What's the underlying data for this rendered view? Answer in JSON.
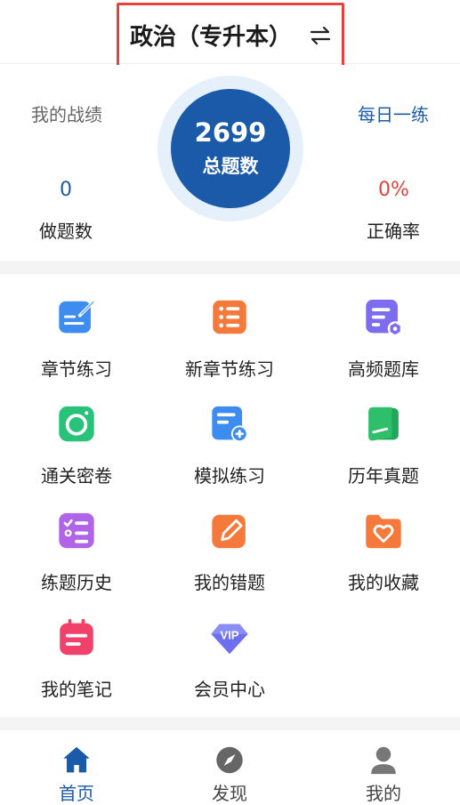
{
  "header": {
    "subject": "政治（专升本）",
    "switch_icon": "swap-arrows-icon"
  },
  "stats": {
    "my_record_label": "我的战绩",
    "daily_practice_label": "每日一练",
    "total_questions": "2699",
    "total_questions_label": "总题数",
    "done_count": "0",
    "done_label": "做题数",
    "accuracy": "0%",
    "accuracy_label": "正确率"
  },
  "menu": {
    "items": [
      {
        "label": "章节练习",
        "icon": "chapter-practice-icon",
        "color": "#3d8df0"
      },
      {
        "label": "新章节练习",
        "icon": "list-icon",
        "color": "#f5793a"
      },
      {
        "label": "高频题库",
        "icon": "question-bank-icon",
        "color": "#7b6cf0"
      },
      {
        "label": "通关密卷",
        "icon": "camera-icon",
        "color": "#28c27a"
      },
      {
        "label": "模拟练习",
        "icon": "add-document-icon",
        "color": "#3d8df0"
      },
      {
        "label": "历年真题",
        "icon": "book-icon",
        "color": "#2fbf6a"
      },
      {
        "label": "练题历史",
        "icon": "checklist-icon",
        "color": "#b065e8"
      },
      {
        "label": "我的错题",
        "icon": "edit-icon",
        "color": "#f5793a"
      },
      {
        "label": "我的收藏",
        "icon": "favorite-folder-icon",
        "color": "#f5793a"
      },
      {
        "label": "我的笔记",
        "icon": "notes-icon",
        "color": "#f0416b"
      },
      {
        "label": "会员中心",
        "icon": "vip-icon",
        "color": "#6c6ff0"
      }
    ]
  },
  "tabbar": {
    "tabs": [
      {
        "label": "首页",
        "icon": "home-icon",
        "active": true
      },
      {
        "label": "发现",
        "icon": "compass-icon",
        "active": false
      },
      {
        "label": "我的",
        "icon": "user-icon",
        "active": false
      }
    ],
    "active_color": "#1a5aa8",
    "inactive_color": "#666666"
  }
}
